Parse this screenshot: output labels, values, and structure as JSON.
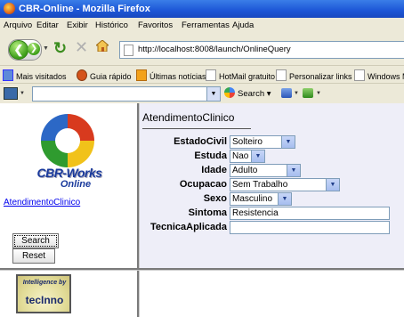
{
  "window": {
    "title": "CBR-Online - Mozilla Firefox"
  },
  "menu": [
    "Arquivo",
    "Editar",
    "Exibir",
    "Histórico",
    "Favoritos",
    "Ferramentas",
    "Ajuda"
  ],
  "nav": {
    "url": "http://localhost:8008/launch/OnlineQuery",
    "icons": [
      "back-icon",
      "forward-icon",
      "reload-icon",
      "stop-icon",
      "home-icon"
    ]
  },
  "bookmarks": [
    "Mais visitados",
    "Guia rápido",
    "Últimas notícias",
    "HotMail gratuito",
    "Personalizar links",
    "Windows M"
  ],
  "toolbar2": {
    "search_label": "Search",
    "search_value": ""
  },
  "sidebar": {
    "logo_text": "CBR-Works",
    "logo_sub": "Online",
    "link": "AtendimentoClinico",
    "search_button": "Search",
    "reset_button": "Reset",
    "badge_top": "Intelligence by",
    "badge_bottom": "tecInno"
  },
  "form": {
    "title": "AtendimentoClinico",
    "fields": [
      {
        "label": "EstadoCivil",
        "value": "Solteiro"
      },
      {
        "label": "Estuda",
        "value": "Nao"
      },
      {
        "label": "Idade",
        "value": "Adulto"
      },
      {
        "label": "Ocupacao",
        "value": "Sem Trabalho"
      },
      {
        "label": "Sexo",
        "value": "Masculino"
      },
      {
        "label": "Sintoma",
        "value": "Resistencia"
      },
      {
        "label": "TecnicaAplicada",
        "value": ""
      }
    ]
  }
}
